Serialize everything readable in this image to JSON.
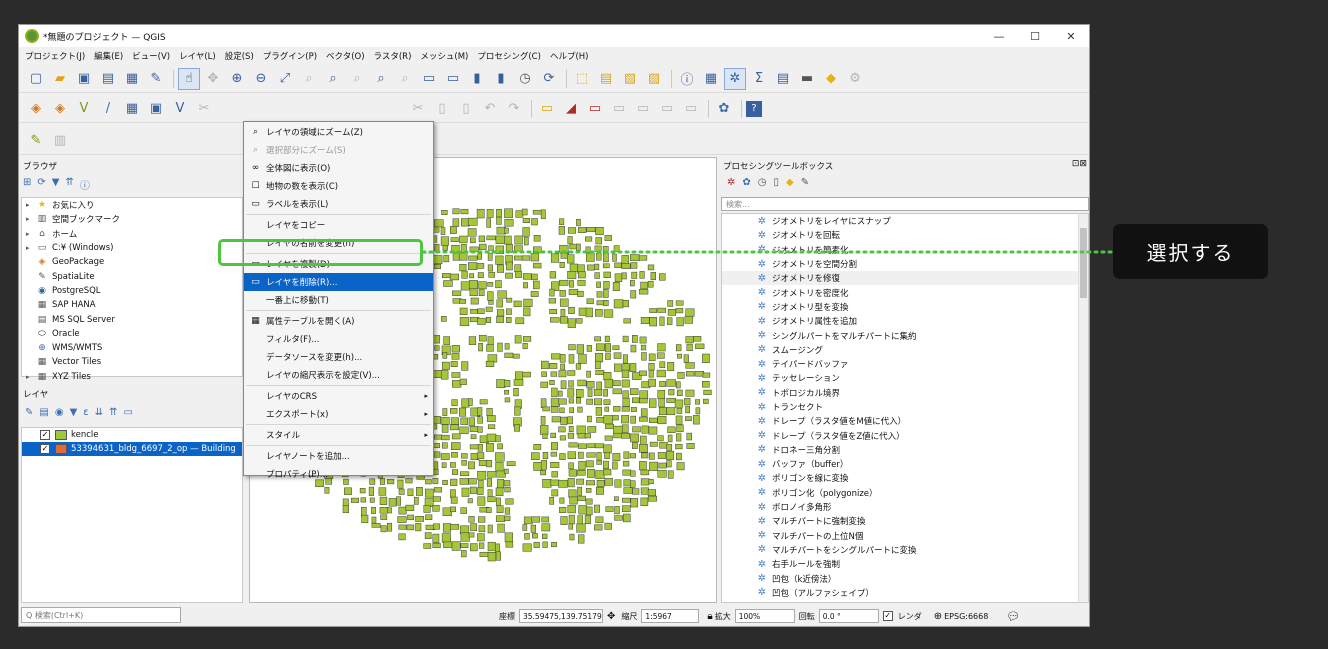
{
  "window": {
    "title": "*無題のプロジェクト — QGIS",
    "controls": [
      "—",
      "☐",
      "✕"
    ]
  },
  "menubar": [
    "プロジェクト(J)",
    "編集(E)",
    "ビュー(V)",
    "レイヤ(L)",
    "設定(S)",
    "プラグイン(P)",
    "ベクタ(O)",
    "ラスタ(R)",
    "メッシュ(M)",
    "プロセシング(C)",
    "ヘルプ(H)"
  ],
  "browser": {
    "title": "ブラウザ",
    "items": [
      {
        "label": "お気に入り",
        "icon": "star-icon"
      },
      {
        "label": "空間ブックマーク",
        "icon": "bookmark-icon"
      },
      {
        "label": "ホーム",
        "icon": "folder-icon"
      },
      {
        "label": "C:¥ (Windows)",
        "icon": "drive-icon"
      },
      {
        "label": "GeoPackage",
        "icon": "geopackage-icon"
      },
      {
        "label": "SpatiaLite",
        "icon": "spatialite-icon"
      },
      {
        "label": "PostgreSQL",
        "icon": "postgresql-icon"
      },
      {
        "label": "SAP HANA",
        "icon": "saphana-icon"
      },
      {
        "label": "MS SQL Server",
        "icon": "mssql-icon"
      },
      {
        "label": "Oracle",
        "icon": "oracle-icon"
      },
      {
        "label": "WMS/WMTS",
        "icon": "wms-icon"
      },
      {
        "label": "Vector Tiles",
        "icon": "vectortiles-icon"
      },
      {
        "label": "XYZ Tiles",
        "icon": "xyz-icon"
      }
    ]
  },
  "layers": {
    "title": "レイヤ",
    "items": [
      {
        "label": "kencle",
        "color": "#9fc93c",
        "checked": true,
        "selected": false
      },
      {
        "label": "53394631_bldg_6697_2_op — Building",
        "color": "#e06a3a",
        "checked": true,
        "selected": true
      }
    ]
  },
  "search_placeholder": "Q 検索(Ctrl+K)",
  "context_menu": {
    "items": [
      {
        "label": "レイヤの領域にズーム(Z)",
        "icon": "zoom-layer-icon",
        "state": "normal"
      },
      {
        "label": "選択部分にズーム(S)",
        "icon": "zoom-selection-icon",
        "state": "disabled"
      },
      {
        "label": "全体図に表示(O)",
        "icon": "overview-icon",
        "state": "normal"
      },
      {
        "label": "地物の数を表示(C)",
        "icon": "checkbox-icon",
        "state": "normal"
      },
      {
        "label": "ラベルを表示(L)",
        "icon": "label-icon",
        "state": "normal"
      },
      {
        "label": "レイヤをコピー",
        "icon": "",
        "state": "normal"
      },
      {
        "label": "レイヤの名前を変更(n)",
        "icon": "",
        "state": "normal"
      },
      {
        "label": "レイヤを複製(D)",
        "icon": "duplicate-icon",
        "state": "normal"
      },
      {
        "label": "レイヤを削除(R)...",
        "icon": "remove-layer-icon",
        "state": "active"
      },
      {
        "label": "一番上に移動(T)",
        "icon": "",
        "state": "normal"
      },
      {
        "label": "属性テーブルを開く(A)",
        "icon": "table-icon",
        "state": "normal"
      },
      {
        "label": "フィルタ(F)...",
        "icon": "",
        "state": "normal"
      },
      {
        "label": "データソースを変更(h)...",
        "icon": "",
        "state": "normal"
      },
      {
        "label": "レイヤの縮尺表示を設定(V)...",
        "icon": "",
        "state": "normal"
      },
      {
        "label": "レイヤのCRS",
        "icon": "",
        "state": "submenu"
      },
      {
        "label": "エクスポート(x)",
        "icon": "",
        "state": "submenu"
      },
      {
        "label": "スタイル",
        "icon": "",
        "state": "submenu"
      },
      {
        "label": "レイヤノートを追加...",
        "icon": "",
        "state": "normal"
      },
      {
        "label": "プロパティ(P)...",
        "icon": "",
        "state": "normal"
      }
    ]
  },
  "toolbox": {
    "title": "プロセシングツールボックス",
    "search_placeholder": "検索...",
    "items": [
      "ジオメトリをレイヤにスナップ",
      "ジオメトリを回転",
      "ジオメトリを簡素化",
      "ジオメトリを空間分割",
      "ジオメトリを修復",
      "ジオメトリを密度化",
      "ジオメトリ型を変換",
      "ジオメトリ属性を追加",
      "シングルパートをマルチパートに集約",
      "スムージング",
      "テイパードバッファ",
      "テッセレーション",
      "トポロジカル境界",
      "トランセクト",
      "ドレープ（ラスタ値をM値に代入）",
      "ドレープ（ラスタ値をZ値に代入）",
      "ドロネー三角分割",
      "バッファ（buffer）",
      "ポリゴンを線に変換",
      "ポリゴン化（polygonize）",
      "ボロノイ多角形",
      "マルチパートに強制変換",
      "マルチパートの上位N個",
      "マルチパートをシングルパートに変換",
      "右手ルールを強制",
      "凹包（k近傍法）",
      "凹包（アルファシェイプ）"
    ]
  },
  "status": {
    "coord_label": "座標",
    "coord_value": "35.59475,139.75179",
    "scale_label": "縮尺",
    "scale_value": "1:5967",
    "magnifier_label": "拡大",
    "magnifier_value": "100%",
    "rotation_label": "回転",
    "rotation_value": "0.0 °",
    "render_label": "レンダ",
    "crs_value": "EPSG:6668"
  },
  "callout": "選択する",
  "colors": {
    "building_fill": "#a6c63a",
    "highlight": "#4cc63f",
    "selection": "#0a64c8"
  }
}
